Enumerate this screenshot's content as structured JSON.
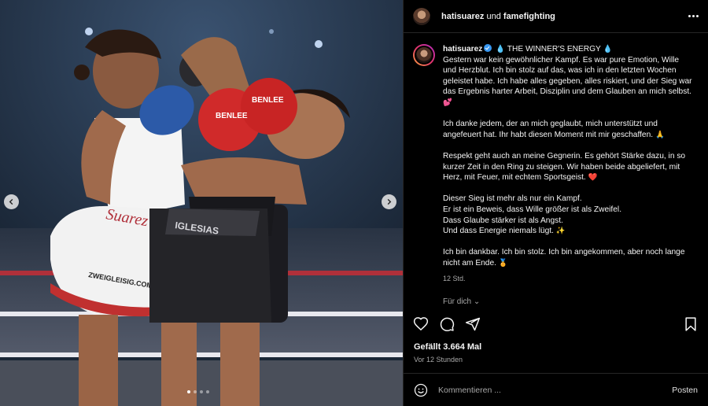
{
  "header": {
    "user1": "hatisuarez",
    "connector": "und",
    "user2": "famefighting",
    "more_icon": "more-horizontal-icon"
  },
  "caption": {
    "username": "hatisuarez",
    "title": "THE WINNER'S ENERGY",
    "paragraphs": [
      "Gestern war kein gewöhnlicher Kampf. Es war pure Emotion, Wille und Herzblut. Ich bin stolz auf das, was ich in den letzten Wochen geleistet habe. Ich habe alles gegeben, alles riskiert, und der Sieg war das Ergebnis harter Arbeit, Disziplin und dem Glauben an mich selbst.",
      "Ich danke jedem, der an mich geglaubt, mich unterstützt und angefeuert hat. Ihr habt diesen Moment mit mir geschaffen.",
      "Respekt geht auch an meine Gegnerin. Es gehört Stärke dazu, in so kurzer Zeit in den Ring zu steigen. Wir haben beide abgeliefert, mit Herz, mit Feuer, mit echtem Sportsgeist.",
      "Dieser Sieg ist mehr als nur ein Kampf.",
      "Er ist ein Beweis, dass Wille größer ist als Zweifel.",
      "Dass Glaube stärker ist als Angst.",
      "Und dass Energie niemals lügt.",
      "Ich bin dankbar. Ich bin stolz. Ich bin angekommen, aber noch lange nicht am Ende."
    ],
    "emojis": {
      "drop": "💧",
      "hearts": "💕",
      "pray": "🙏",
      "heart": "❤️",
      "sparkles": "✨",
      "medal": "🏅"
    },
    "time": "12 Std.",
    "more_posts": "Für dich ⌄"
  },
  "actions": {
    "like_icon": "heart-icon",
    "comment_icon": "comment-icon",
    "share_icon": "share-icon",
    "save_icon": "bookmark-icon"
  },
  "likes": "Gefällt 3.664 Mal",
  "posted": "Vor 12 Stunden",
  "comment": {
    "placeholder": "Kommentieren ...",
    "post_label": "Posten",
    "emoji_icon": "smiley-icon"
  },
  "media": {
    "corner_text_left": "Suarez",
    "sponsor": "ZWEIGLEISIG.COM",
    "glove_brand": "BENLEE",
    "shorts_text": "IGLESIAS",
    "carousel": {
      "count": 4,
      "active": 0
    }
  },
  "colors": {
    "accent_blue": "#3897f0",
    "story_ring": [
      "#f9a23b",
      "#e0336b",
      "#b12cc2"
    ],
    "secondary_text": "#a8a8a8"
  }
}
